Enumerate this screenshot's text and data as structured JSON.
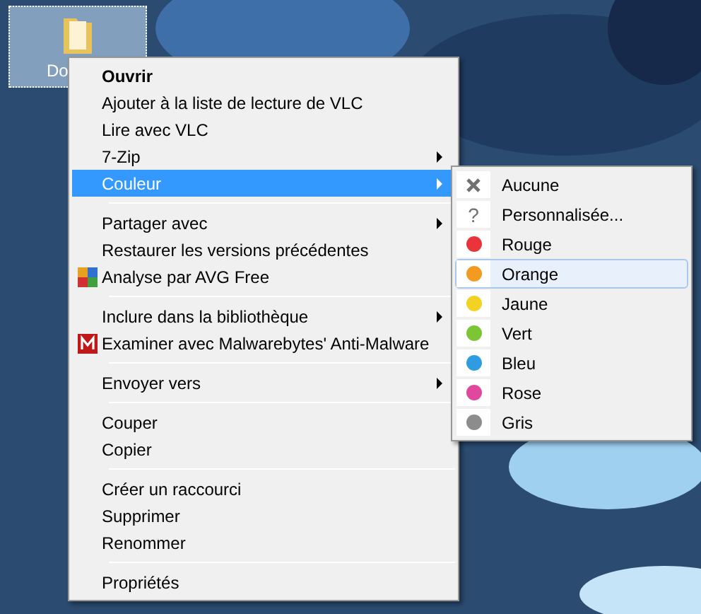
{
  "desktop_icon": {
    "label": "Do",
    "selected": true
  },
  "context_menu": {
    "items": [
      {
        "kind": "item",
        "label": "Ouvrir",
        "default": true,
        "selected": false,
        "submenu": false
      },
      {
        "kind": "item",
        "label": "Ajouter à la liste de lecture de VLC",
        "default": false,
        "selected": false,
        "submenu": false
      },
      {
        "kind": "item",
        "label": "Lire avec VLC",
        "default": false,
        "selected": false,
        "submenu": false
      },
      {
        "kind": "item",
        "label": "7-Zip",
        "default": false,
        "selected": false,
        "submenu": true
      },
      {
        "kind": "item",
        "label": "Couleur",
        "default": false,
        "selected": true,
        "submenu": true
      },
      {
        "kind": "separator"
      },
      {
        "kind": "item",
        "label": "Partager avec",
        "default": false,
        "selected": false,
        "submenu": true
      },
      {
        "kind": "item",
        "label": "Restaurer les versions précédentes",
        "default": false,
        "selected": false,
        "submenu": false
      },
      {
        "kind": "squares",
        "label": "Analyse par AVG Free",
        "default": false,
        "selected": false,
        "submenu": false
      },
      {
        "kind": "separator"
      },
      {
        "kind": "item",
        "label": "Inclure dans la bibliothèque",
        "default": false,
        "selected": false,
        "submenu": true
      },
      {
        "kind": "badge",
        "label": "Examiner avec Malwarebytes' Anti-Malware",
        "default": false,
        "selected": false,
        "submenu": false
      },
      {
        "kind": "separator"
      },
      {
        "kind": "item",
        "label": "Envoyer vers",
        "default": false,
        "selected": false,
        "submenu": true
      },
      {
        "kind": "separator"
      },
      {
        "kind": "item",
        "label": "Couper",
        "default": false,
        "selected": false,
        "submenu": false
      },
      {
        "kind": "item",
        "label": "Copier",
        "default": false,
        "selected": false,
        "submenu": false
      },
      {
        "kind": "separator"
      },
      {
        "kind": "item",
        "label": "Créer un raccourci",
        "default": false,
        "selected": false,
        "submenu": false
      },
      {
        "kind": "item",
        "label": "Supprimer",
        "default": false,
        "selected": false,
        "submenu": false
      },
      {
        "kind": "item",
        "label": "Renommer",
        "default": false,
        "selected": false,
        "submenu": false
      },
      {
        "kind": "separator"
      },
      {
        "kind": "item",
        "label": "Propriétés",
        "default": false,
        "selected": false,
        "submenu": false
      }
    ]
  },
  "color_submenu": {
    "items": [
      {
        "kind": "cross",
        "label": "Aucune",
        "selected": false
      },
      {
        "kind": "question",
        "glyph": "?",
        "label": "Personnalisée...",
        "selected": false
      },
      {
        "kind": "dot",
        "label": "Rouge",
        "color": "#e8343a",
        "selected": false
      },
      {
        "kind": "dot",
        "label": "Orange",
        "color": "#f39a22",
        "selected": true
      },
      {
        "kind": "dot",
        "label": "Jaune",
        "color": "#f2d225",
        "selected": false
      },
      {
        "kind": "dot",
        "label": "Vert",
        "color": "#7cc636",
        "selected": false
      },
      {
        "kind": "dot",
        "label": "Bleu",
        "color": "#2f9be0",
        "selected": false
      },
      {
        "kind": "dot",
        "label": "Rose",
        "color": "#e0489e",
        "selected": false
      },
      {
        "kind": "dot",
        "label": "Gris",
        "color": "#8c8c8c",
        "selected": false
      }
    ]
  }
}
